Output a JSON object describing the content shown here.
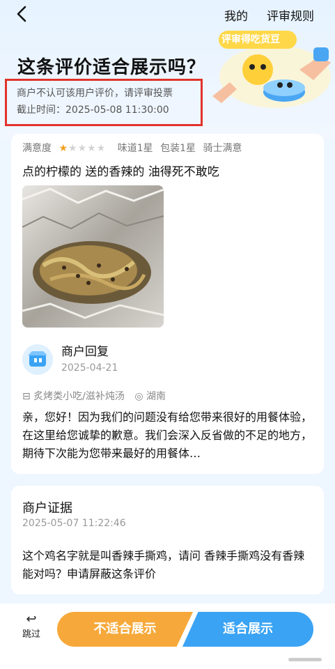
{
  "nav": {
    "mine": "我的",
    "rules": "评审规则"
  },
  "banner": {
    "text": "评审得吃货豆"
  },
  "title": "这条评价适合展示吗？",
  "notice": {
    "line1": "商户不认可该用户评价，请评审投票",
    "line2": "截止时间：2025-05-08 11:30:00"
  },
  "rating": {
    "label": "满意度",
    "stars": 1,
    "max_stars": 5,
    "taste": "味道1星",
    "packaging": "包装1星",
    "rider": "骑士满意"
  },
  "review": {
    "text": "点的柠檬的 送的香辣的 油得死不敢吃"
  },
  "reply": {
    "title": "商户回复",
    "date": "2025-04-21",
    "tag1": "炙烤类小吃/滋补炖汤",
    "tag2": "湖南",
    "text": "亲，您好！因为我们的问题没有给您带来很好的用餐体验，在这里给您诚挚的歉意。我们会深入反省做的不足的地方，期待下次能为您带来最好的用餐体…"
  },
  "evidence": {
    "title": "商户证据",
    "date": "2025-05-07 11:22:46",
    "text": "这个鸡名字就是叫香辣手撕鸡，请问 香辣手撕鸡没有香辣能对吗？申请屏蔽这条评价"
  },
  "bottom": {
    "skip": "跳过",
    "not_suitable": "不适合展示",
    "suitable": "适合展示"
  },
  "colors": {
    "accent_orange": "#f6a93a",
    "accent_blue": "#3aa3f4",
    "notice_border": "#e1332b",
    "star": "#f2a01f"
  }
}
